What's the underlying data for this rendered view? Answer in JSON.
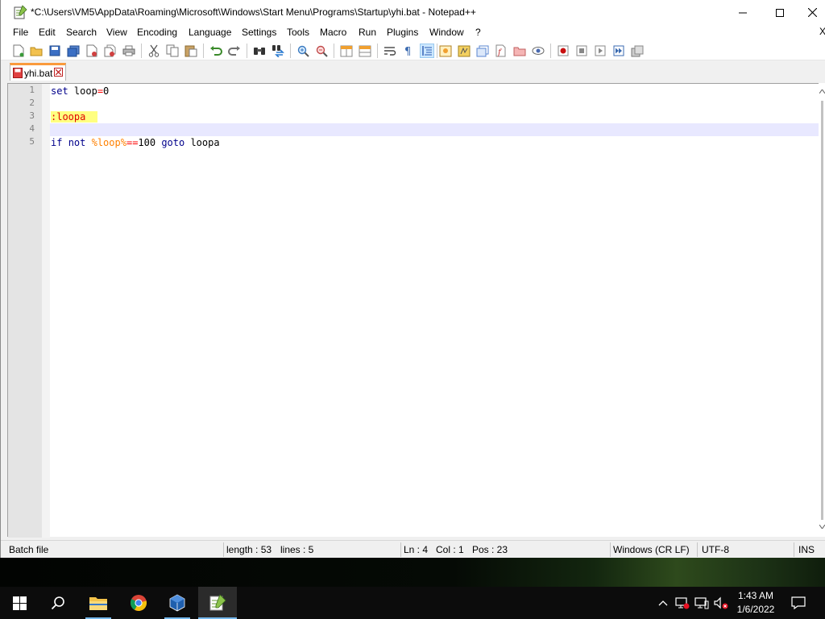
{
  "window": {
    "title": "*C:\\Users\\VM5\\AppData\\Roaming\\Microsoft\\Windows\\Start Menu\\Programs\\Startup\\yhi.bat - Notepad++"
  },
  "menu": [
    "File",
    "Edit",
    "Search",
    "View",
    "Encoding",
    "Language",
    "Settings",
    "Tools",
    "Macro",
    "Run",
    "Plugins",
    "Window",
    "?"
  ],
  "menu_close_doc": "X",
  "toolbar": {
    "icons": [
      "new-file-icon",
      "open-file-icon",
      "save-icon",
      "save-all-icon",
      "close-icon",
      "close-all-icon",
      "print-icon",
      "cut-icon",
      "copy-icon",
      "paste-icon",
      "undo-icon",
      "redo-icon",
      "find-icon",
      "replace-icon",
      "zoom-in-icon",
      "zoom-out-icon",
      "sync-vertical-icon",
      "sync-horizontal-icon",
      "word-wrap-icon",
      "show-all-chars-icon",
      "indent-guide-icon",
      "user-language-icon",
      "document-map-icon",
      "function-list-icon",
      "folder-workspace-icon",
      "monitoring-icon",
      "record-macro-icon",
      "stop-record-icon",
      "play-macro-icon",
      "run-macro-multiple-icon",
      "save-macro-icon"
    ],
    "active_icon": "indent-guide-icon"
  },
  "tab": {
    "label": "yhi.bat"
  },
  "editor": {
    "lines": [
      {
        "num": "1",
        "tokens": [
          {
            "t": "set",
            "c": "kw"
          },
          {
            "t": " loop",
            "c": "plain"
          },
          {
            "t": "=",
            "c": "op"
          },
          {
            "t": "0",
            "c": "num"
          }
        ]
      },
      {
        "num": "2",
        "tokens": []
      },
      {
        "num": "3",
        "tokens": [
          {
            "t": ":loopa  ",
            "c": "label"
          }
        ]
      },
      {
        "num": "4",
        "tokens": []
      },
      {
        "num": "5",
        "tokens": [
          {
            "t": "if",
            "c": "kw"
          },
          {
            "t": " ",
            "c": "plain"
          },
          {
            "t": "not",
            "c": "kw"
          },
          {
            "t": " ",
            "c": "plain"
          },
          {
            "t": "%loop%",
            "c": "var"
          },
          {
            "t": "==",
            "c": "op"
          },
          {
            "t": "100 ",
            "c": "num"
          },
          {
            "t": "goto",
            "c": "kw"
          },
          {
            "t": " loopa",
            "c": "plain"
          }
        ]
      }
    ],
    "caret_line": 4
  },
  "status": {
    "language": "Batch file",
    "length": "length : 53",
    "lines": "lines : 5",
    "ln": "Ln : 4",
    "col": "Col : 1",
    "pos": "Pos : 23",
    "eol": "Windows (CR LF)",
    "encoding": "UTF-8",
    "mode": "INS"
  },
  "taskbar": {
    "time": "1:43 AM",
    "date": "1/6/2022"
  },
  "colors": {
    "keyword": "#00008b",
    "operator": "#ff0000",
    "variable": "#ff8000",
    "label_bg": "#ffff80",
    "caret_line": "#e8e8ff",
    "tab_accent": "#fa9a3c"
  }
}
